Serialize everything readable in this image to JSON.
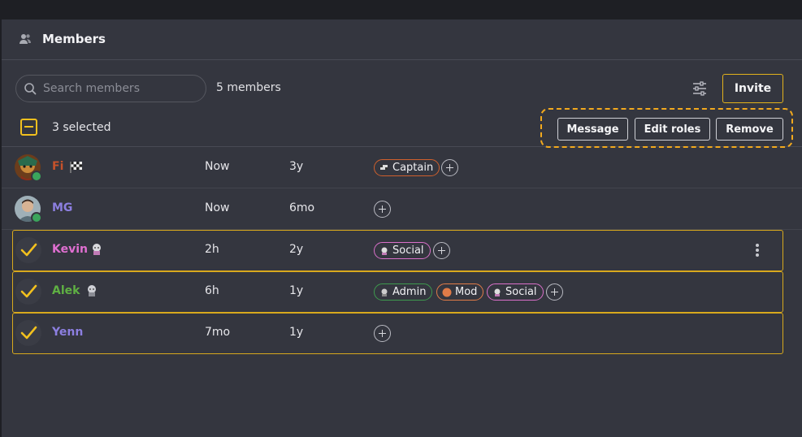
{
  "header": {
    "title": "Members",
    "icon": "members-icon"
  },
  "search": {
    "placeholder": "Search members",
    "value": ""
  },
  "member_count": "5 members",
  "invite_label": "Invite",
  "selection": {
    "text": "3 selected",
    "state": "indeterminate"
  },
  "bulk_actions": {
    "message": "Message",
    "edit_roles": "Edit roles",
    "remove": "Remove"
  },
  "colors": {
    "accent": "#f2c01e",
    "online": "#3ba55c",
    "panel": "#34363f"
  },
  "members": [
    {
      "name": "Fi",
      "name_color": "#c6522b",
      "last_active": "Now",
      "joined": "3y",
      "online": true,
      "selected": false,
      "roles": [
        {
          "label": "Captain",
          "color": "#d0602d"
        }
      ]
    },
    {
      "name": "MG",
      "name_color": "#8c7fe0",
      "last_active": "Now",
      "joined": "6mo",
      "online": true,
      "selected": false,
      "roles": []
    },
    {
      "name": "Kevin",
      "name_color": "#e06fd1",
      "last_active": "2h",
      "joined": "2y",
      "online": false,
      "selected": true,
      "roles": [
        {
          "label": "Social",
          "color": "#d970c9"
        }
      ]
    },
    {
      "name": "Alek",
      "name_color": "#5fb043",
      "last_active": "6h",
      "joined": "1y",
      "online": false,
      "selected": true,
      "roles": [
        {
          "label": "Admin",
          "color": "#3e9a4e"
        },
        {
          "label": "Mod",
          "color": "#e07b48"
        },
        {
          "label": "Social",
          "color": "#d970c9"
        }
      ]
    },
    {
      "name": "Yenn",
      "name_color": "#8c7fe0",
      "last_active": "7mo",
      "joined": "1y",
      "online": false,
      "selected": true,
      "roles": []
    }
  ]
}
